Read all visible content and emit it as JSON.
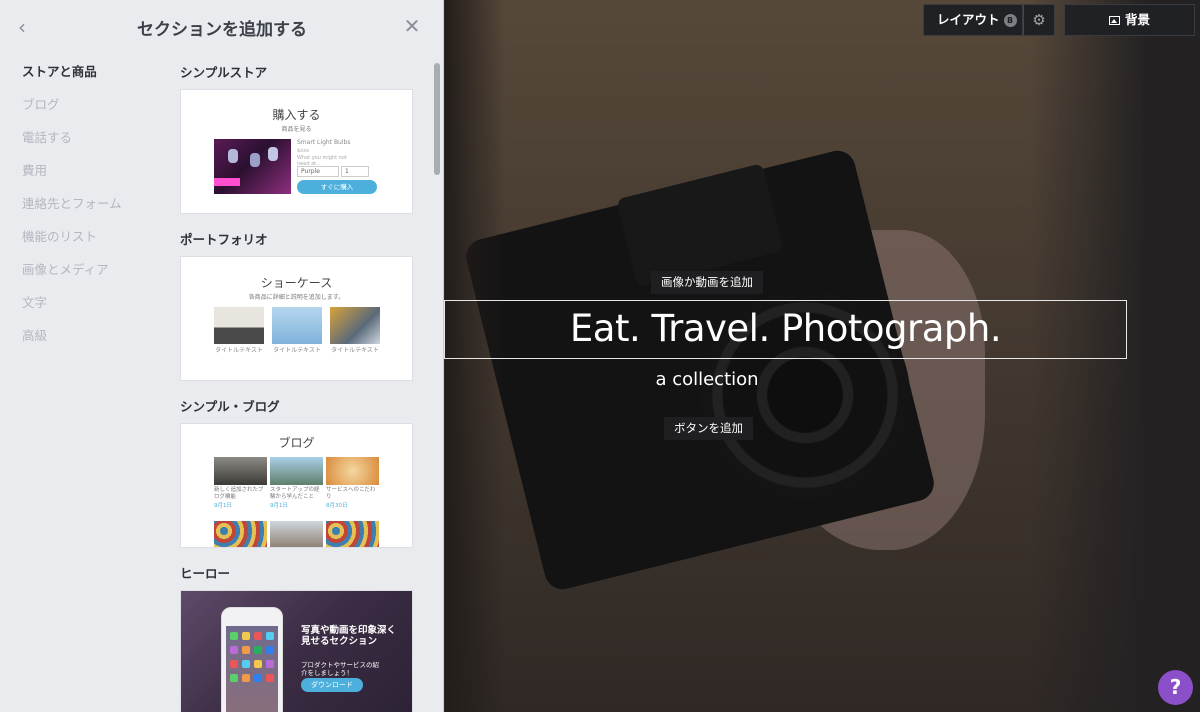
{
  "panel": {
    "title": "セクションを追加する",
    "back_icon": "chevron-left-icon",
    "close_icon": "close-icon"
  },
  "categories": [
    {
      "label": "ストアと商品",
      "active": true
    },
    {
      "label": "ブログ",
      "active": false
    },
    {
      "label": "電話する",
      "active": false
    },
    {
      "label": "費用",
      "active": false
    },
    {
      "label": "連絡先とフォーム",
      "active": false
    },
    {
      "label": "機能のリスト",
      "active": false
    },
    {
      "label": "画像とメディア",
      "active": false
    },
    {
      "label": "文字",
      "active": false
    },
    {
      "label": "高級",
      "active": false
    }
  ],
  "sections": {
    "store": {
      "label": "シンプルストア",
      "preview": {
        "title": "購入する",
        "subtitle": "商品を見る",
        "product_name": "Smart Light Bulbs",
        "price": "$xxx",
        "desc": "What you might not need at...",
        "option": "Purple",
        "qty": "1",
        "button": "すぐに購入"
      }
    },
    "portfolio": {
      "label": "ポートフォリオ",
      "preview": {
        "title": "ショーケース",
        "subtitle": "各商品に詳細と説明を追加します。",
        "captions": [
          "タイトルテキスト",
          "タイトルテキスト",
          "タイトルテキスト"
        ]
      }
    },
    "blog": {
      "label": "シンプル・ブログ",
      "preview": {
        "title": "ブログ",
        "posts": [
          {
            "caption": "新しく追加されたブログ機能",
            "date": "9月1日"
          },
          {
            "caption": "スタートアップの経験から学んだこと",
            "date": "9月1日"
          },
          {
            "caption": "サービスへのこだわり",
            "date": "8月30日"
          }
        ]
      }
    },
    "hero": {
      "label": "ヒーロー",
      "preview": {
        "heading": "写真や動画を印象深く見せるセクション",
        "sub": "プロダクトやサービスの紹介をしましょう！",
        "button": "ダウンロード"
      }
    }
  },
  "canvas": {
    "add_media": "画像か動画を追加",
    "headline": "Eat. Travel. Photograph.",
    "subline": "a collection",
    "add_button": "ボタンを追加"
  },
  "toolbar": {
    "layout_label": "レイアウト",
    "layout_badge": "B",
    "settings_icon": "gear-icon",
    "background_label": "背景",
    "background_icon": "image-icon"
  },
  "help": {
    "label": "?"
  }
}
